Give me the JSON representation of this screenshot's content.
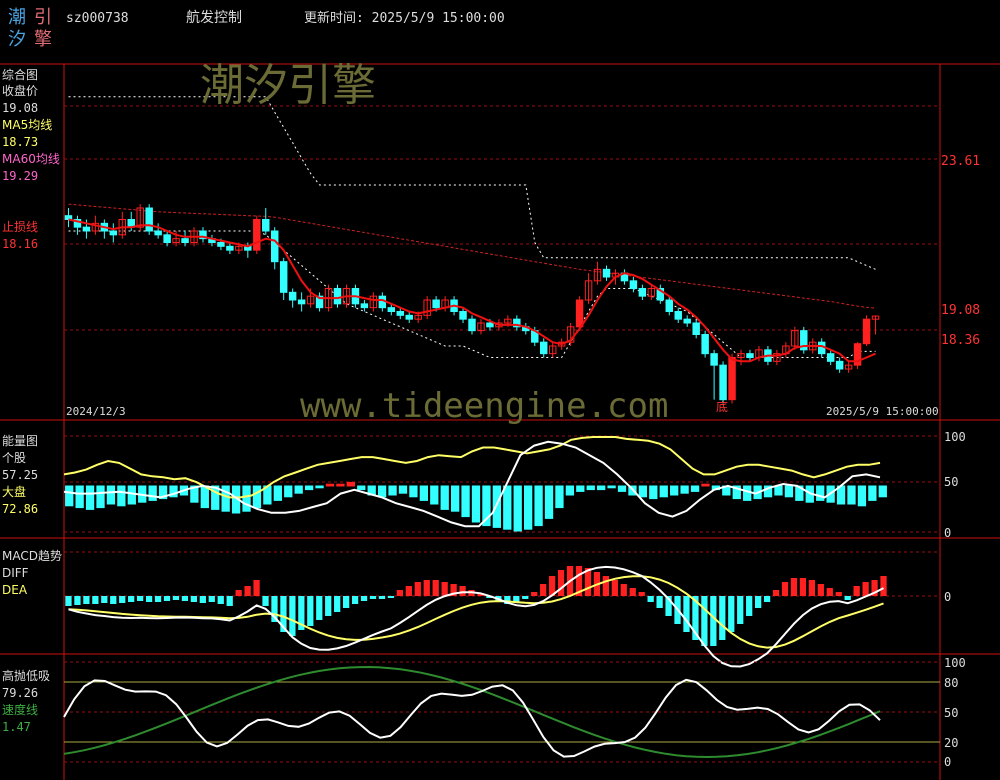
{
  "header": {
    "logo_chars": [
      "潮",
      "引",
      "汐",
      "擎"
    ],
    "stock_code": "sz000738",
    "stock_name": "航发控制",
    "update_label": "更新时间: 2025/5/9 15:00:00"
  },
  "colors": {
    "up": "#ff2020",
    "down": "#33ffff",
    "ma5": "#ffff66",
    "ma60": "#ff66cc",
    "stoploss": "#ff3333",
    "grid": "#aa1111",
    "white": "#ffffff",
    "green": "#2e8b2e"
  },
  "watermark": {
    "cn": "潮汐引擎",
    "url": "www.tideengine.com"
  },
  "panel_main": {
    "title": "综合图",
    "close_label": "收盘价",
    "close_value": "19.08",
    "ma5_label": "MA5均线",
    "ma5_value": "18.73",
    "ma60_label": "MA60均线",
    "ma60_value": "19.29",
    "stop_label": "止损线",
    "stop_value": "18.16",
    "right_ticks": [
      "23.61",
      "19.08",
      "18.36"
    ],
    "bottom_marker": "底",
    "date_start": "2024/12/3",
    "date_end": "2025/5/9 15:00:00"
  },
  "panel_energy": {
    "title": "能量图",
    "stock_label": "个股",
    "stock_value": "57.25",
    "market_label": "大盘",
    "market_value": "72.86",
    "right_ticks": [
      "100",
      "50",
      "0"
    ]
  },
  "panel_macd": {
    "title": "MACD趋势",
    "diff_label": "DIFF",
    "dea_label": "DEA",
    "right_ticks": [
      "0"
    ]
  },
  "panel_gpdx": {
    "title": "高抛低吸",
    "value": "79.26",
    "speed_label": "速度线",
    "speed_value": "1.47",
    "right_ticks": [
      "100",
      "80",
      "50",
      "20",
      "0"
    ]
  },
  "chart_data": {
    "type": "candlestick",
    "ylim": [
      16.5,
      25.5
    ],
    "dates_span": [
      "2024/12/3",
      "2025/5/9"
    ],
    "candles": [
      [
        21.7,
        21.6,
        21.9,
        21.4
      ],
      [
        21.6,
        21.4,
        21.7,
        21.2
      ],
      [
        21.4,
        21.3,
        21.6,
        21.1
      ],
      [
        21.3,
        21.5,
        21.7,
        21.2
      ],
      [
        21.5,
        21.3,
        21.6,
        21.1
      ],
      [
        21.3,
        21.2,
        21.5,
        21.0
      ],
      [
        21.2,
        21.6,
        21.8,
        21.1
      ],
      [
        21.6,
        21.4,
        21.8,
        21.3
      ],
      [
        21.4,
        21.9,
        22.0,
        21.3
      ],
      [
        21.9,
        21.3,
        22.0,
        21.2
      ],
      [
        21.3,
        21.2,
        21.5,
        21.1
      ],
      [
        21.2,
        21.0,
        21.3,
        20.9
      ],
      [
        21.0,
        21.1,
        21.3,
        20.9
      ],
      [
        21.1,
        21.0,
        21.3,
        20.9
      ],
      [
        21.0,
        21.3,
        21.4,
        20.9
      ],
      [
        21.3,
        21.1,
        21.4,
        21.0
      ],
      [
        21.1,
        21.0,
        21.2,
        20.9
      ],
      [
        21.0,
        20.9,
        21.1,
        20.8
      ],
      [
        20.9,
        20.8,
        21.0,
        20.7
      ],
      [
        20.8,
        20.9,
        21.0,
        20.7
      ],
      [
        20.9,
        20.8,
        21.0,
        20.6
      ],
      [
        20.8,
        21.6,
        21.7,
        20.7
      ],
      [
        21.6,
        21.3,
        21.9,
        21.2
      ],
      [
        21.3,
        20.5,
        21.4,
        20.3
      ],
      [
        20.5,
        19.7,
        20.6,
        19.5
      ],
      [
        19.7,
        19.5,
        19.8,
        19.3
      ],
      [
        19.5,
        19.4,
        19.7,
        19.2
      ],
      [
        19.4,
        19.6,
        19.8,
        19.3
      ],
      [
        19.6,
        19.3,
        19.7,
        19.2
      ],
      [
        19.3,
        19.8,
        19.9,
        19.2
      ],
      [
        19.8,
        19.4,
        19.9,
        19.3
      ],
      [
        19.4,
        19.8,
        19.9,
        19.3
      ],
      [
        19.8,
        19.4,
        19.9,
        19.3
      ],
      [
        19.4,
        19.3,
        19.5,
        19.2
      ],
      [
        19.3,
        19.6,
        19.7,
        19.2
      ],
      [
        19.6,
        19.3,
        19.7,
        19.2
      ],
      [
        19.3,
        19.2,
        19.4,
        19.1
      ],
      [
        19.2,
        19.1,
        19.3,
        19.0
      ],
      [
        19.1,
        19.0,
        19.2,
        18.9
      ],
      [
        19.0,
        19.1,
        19.2,
        18.9
      ],
      [
        19.1,
        19.5,
        19.6,
        19.0
      ],
      [
        19.5,
        19.3,
        19.6,
        19.2
      ],
      [
        19.3,
        19.5,
        19.6,
        19.2
      ],
      [
        19.5,
        19.2,
        19.6,
        19.1
      ],
      [
        19.2,
        19.0,
        19.3,
        18.9
      ],
      [
        19.0,
        18.7,
        19.1,
        18.6
      ],
      [
        18.7,
        18.9,
        19.0,
        18.6
      ],
      [
        18.9,
        18.8,
        19.0,
        18.7
      ],
      [
        18.8,
        18.9,
        19.0,
        18.7
      ],
      [
        18.9,
        19.0,
        19.1,
        18.8
      ],
      [
        19.0,
        18.8,
        19.1,
        18.7
      ],
      [
        18.8,
        18.7,
        18.9,
        18.6
      ],
      [
        18.7,
        18.4,
        18.8,
        18.3
      ],
      [
        18.4,
        18.1,
        18.5,
        18.0
      ],
      [
        18.1,
        18.3,
        18.4,
        18.0
      ],
      [
        18.3,
        18.4,
        18.5,
        18.2
      ],
      [
        18.4,
        18.8,
        18.9,
        18.3
      ],
      [
        18.8,
        19.5,
        19.6,
        18.7
      ],
      [
        19.5,
        20.0,
        20.2,
        19.4
      ],
      [
        20.0,
        20.3,
        20.5,
        19.9
      ],
      [
        20.3,
        20.1,
        20.4,
        20.0
      ],
      [
        20.1,
        20.2,
        20.3,
        19.9
      ],
      [
        20.2,
        20.0,
        20.3,
        19.9
      ],
      [
        20.0,
        19.8,
        20.1,
        19.7
      ],
      [
        19.8,
        19.6,
        19.9,
        19.5
      ],
      [
        19.6,
        19.8,
        19.9,
        19.5
      ],
      [
        19.8,
        19.5,
        19.9,
        19.4
      ],
      [
        19.5,
        19.2,
        19.6,
        19.1
      ],
      [
        19.2,
        19.0,
        19.3,
        18.9
      ],
      [
        19.0,
        18.9,
        19.1,
        18.8
      ],
      [
        18.9,
        18.6,
        19.0,
        18.5
      ],
      [
        18.6,
        18.1,
        18.7,
        18.0
      ],
      [
        18.1,
        17.8,
        18.2,
        16.9
      ],
      [
        17.8,
        16.9,
        17.9,
        16.8
      ],
      [
        16.9,
        18.0,
        18.1,
        16.8
      ],
      [
        18.0,
        18.1,
        18.2,
        17.8
      ],
      [
        18.1,
        18.0,
        18.2,
        17.9
      ],
      [
        18.0,
        18.2,
        18.3,
        17.9
      ],
      [
        18.2,
        17.9,
        18.3,
        17.8
      ],
      [
        17.9,
        18.1,
        18.2,
        17.8
      ],
      [
        18.1,
        18.3,
        18.4,
        18.0
      ],
      [
        18.3,
        18.7,
        18.8,
        18.2
      ],
      [
        18.7,
        18.2,
        18.8,
        18.1
      ],
      [
        18.2,
        18.4,
        18.5,
        18.1
      ],
      [
        18.4,
        18.1,
        18.5,
        18.0
      ],
      [
        18.1,
        17.9,
        18.2,
        17.8
      ],
      [
        17.9,
        17.7,
        18.0,
        17.6
      ],
      [
        17.7,
        17.8,
        17.9,
        17.6
      ],
      [
        17.8,
        18.36,
        18.4,
        17.7
      ],
      [
        18.36,
        19.0,
        19.1,
        18.3
      ],
      [
        19.0,
        19.08,
        19.1,
        18.6
      ]
    ],
    "ma5": [
      21.6,
      21.55,
      21.5,
      21.45,
      21.4,
      21.35,
      21.4,
      21.4,
      21.45,
      21.45,
      21.4,
      21.3,
      21.2,
      21.15,
      21.15,
      21.15,
      21.1,
      21.05,
      21.0,
      20.95,
      20.9,
      21.0,
      21.1,
      21.05,
      20.8,
      20.4,
      20.0,
      19.7,
      19.55,
      19.55,
      19.55,
      19.6,
      19.6,
      19.55,
      19.5,
      19.5,
      19.4,
      19.3,
      19.2,
      19.15,
      19.2,
      19.25,
      19.3,
      19.35,
      19.3,
      19.15,
      19.05,
      18.95,
      18.85,
      18.85,
      18.85,
      18.8,
      18.7,
      18.55,
      18.4,
      18.35,
      18.45,
      18.75,
      19.1,
      19.5,
      19.85,
      20.1,
      20.2,
      20.15,
      20.05,
      19.9,
      19.75,
      19.6,
      19.4,
      19.25,
      19.05,
      18.8,
      18.5,
      18.2,
      17.95,
      17.9,
      17.9,
      18.0,
      18.05,
      18.05,
      18.1,
      18.25,
      18.3,
      18.3,
      18.3,
      18.2,
      18.1,
      17.9,
      17.9,
      18.0,
      18.1
    ],
    "ma60": [
      22.0,
      21.98,
      21.96,
      21.94,
      21.92,
      21.9,
      21.88,
      21.86,
      21.84,
      21.82,
      21.8,
      21.79,
      21.78,
      21.77,
      21.76,
      21.75,
      21.74,
      21.73,
      21.72,
      21.71,
      21.7,
      21.69,
      21.68,
      21.66,
      21.62,
      21.58,
      21.54,
      21.5,
      21.46,
      21.42,
      21.38,
      21.34,
      21.3,
      21.26,
      21.22,
      21.18,
      21.14,
      21.1,
      21.06,
      21.02,
      20.98,
      20.94,
      20.9,
      20.86,
      20.82,
      20.78,
      20.74,
      20.7,
      20.66,
      20.62,
      20.58,
      20.54,
      20.5,
      20.46,
      20.42,
      20.38,
      20.34,
      20.3,
      20.27,
      20.24,
      20.21,
      20.18,
      20.15,
      20.12,
      20.09,
      20.06,
      20.03,
      20.0,
      19.97,
      19.94,
      19.91,
      19.88,
      19.85,
      19.82,
      19.79,
      19.76,
      19.73,
      19.7,
      19.67,
      19.64,
      19.61,
      19.58,
      19.55,
      19.52,
      19.49,
      19.46,
      19.42,
      19.38,
      19.34,
      19.31,
      19.29
    ],
    "stoploss": [
      21.3,
      21.3,
      21.3,
      21.3,
      21.3,
      21.3,
      21.3,
      21.3,
      21.3,
      21.3,
      21.3,
      21.3,
      21.3,
      21.3,
      21.3,
      21.3,
      21.3,
      21.3,
      21.3,
      21.3,
      21.3,
      21.3,
      21.2,
      21.0,
      20.8,
      20.6,
      20.4,
      20.2,
      20.0,
      19.8,
      19.6,
      19.4,
      19.3,
      19.2,
      19.1,
      19.0,
      18.9,
      18.8,
      18.7,
      18.6,
      18.5,
      18.4,
      18.3,
      18.3,
      18.3,
      18.2,
      18.1,
      18.0,
      18.0,
      18.0,
      18.0,
      18.0,
      18.0,
      18.0,
      18.0,
      18.0,
      18.4,
      18.8,
      19.2,
      19.6,
      19.8,
      19.8,
      19.8,
      19.8,
      19.7,
      19.6,
      19.5,
      19.4,
      19.3,
      19.2,
      19.0,
      18.8,
      18.6,
      18.4,
      18.2,
      18.0,
      18.0,
      18.0,
      18.0,
      18.0,
      18.0,
      18.0,
      18.0,
      18.0,
      18.0,
      18.0,
      18.0,
      18.0,
      18.16,
      18.16,
      18.16
    ],
    "resistance": [
      24.8,
      24.8,
      24.8,
      24.8,
      24.8,
      24.8,
      24.8,
      24.8,
      24.8,
      24.8,
      24.8,
      24.8,
      24.8,
      24.8,
      24.8,
      24.8,
      24.8,
      24.8,
      24.8,
      24.8,
      24.8,
      24.8,
      24.8,
      24.4,
      24.0,
      23.6,
      23.2,
      22.8,
      22.5,
      22.5,
      22.5,
      22.5,
      22.5,
      22.5,
      22.5,
      22.5,
      22.5,
      22.5,
      22.5,
      22.5,
      22.5,
      22.5,
      22.5,
      22.5,
      22.5,
      22.5,
      22.5,
      22.5,
      22.5,
      22.5,
      22.5,
      22.5,
      21.0,
      20.6,
      20.6,
      20.6,
      20.6,
      20.6,
      20.6,
      20.6,
      20.6,
      20.6,
      20.6,
      20.6,
      20.6,
      20.6,
      20.6,
      20.6,
      20.6,
      20.6,
      20.6,
      20.6,
      20.6,
      20.6,
      20.6,
      20.6,
      20.6,
      20.6,
      20.6,
      20.6,
      20.6,
      20.6,
      20.6,
      20.6,
      20.6,
      20.6,
      20.6,
      20.6,
      20.5,
      20.4,
      20.3
    ],
    "energy_market": [
      60,
      62,
      65,
      70,
      74,
      72,
      66,
      60,
      58,
      57,
      55,
      56,
      52,
      46,
      40,
      36,
      36,
      38,
      44,
      52,
      58,
      62,
      66,
      70,
      72,
      74,
      76,
      78,
      78,
      76,
      74,
      72,
      74,
      78,
      80,
      79,
      78,
      84,
      88,
      88,
      86,
      84,
      82,
      84,
      86,
      90,
      96,
      98,
      99,
      99,
      99,
      97,
      96,
      95,
      92,
      86,
      76,
      66,
      60,
      60,
      64,
      68,
      70,
      70,
      68,
      66,
      64,
      60,
      57,
      60,
      64,
      68,
      70,
      70,
      72
    ],
    "energy_stock": [
      42,
      40,
      40,
      41,
      42,
      40,
      38,
      36,
      40,
      45,
      48,
      46,
      40,
      30,
      24,
      20,
      20,
      22,
      26,
      30,
      40,
      44,
      40,
      36,
      30,
      26,
      22,
      16,
      10,
      6,
      6,
      20,
      50,
      80,
      90,
      94,
      92,
      88,
      80,
      72,
      60,
      46,
      30,
      20,
      16,
      22,
      34,
      44,
      48,
      44,
      40,
      46,
      50,
      48,
      40,
      36,
      46,
      58,
      60,
      57
    ],
    "energy_bars": [
      -22,
      -24,
      -26,
      -24,
      -20,
      -22,
      -20,
      -18,
      -16,
      -14,
      -12,
      -10,
      -18,
      -24,
      -26,
      -28,
      -30,
      -28,
      -24,
      -20,
      -16,
      -12,
      -8,
      -4,
      -2,
      2,
      2,
      4,
      -4,
      -10,
      -12,
      -10,
      -8,
      -12,
      -16,
      -20,
      -26,
      -28,
      -34,
      -40,
      -44,
      -46,
      -48,
      -50,
      -48,
      -44,
      -36,
      -24,
      -10,
      -6,
      -4,
      -4,
      -2,
      -6,
      -10,
      -12,
      -14,
      -12,
      -10,
      -8,
      -6,
      2,
      -4,
      -10,
      -14,
      -16,
      -14,
      -12,
      -10,
      -12,
      -16,
      -18,
      -16,
      -18,
      -20,
      -20,
      -22,
      -16,
      -12
    ],
    "macd_bars": [
      -10,
      -9,
      -8,
      -8,
      -7,
      -8,
      -7,
      -6,
      -5,
      -6,
      -6,
      -5,
      -4,
      -5,
      -6,
      -7,
      -6,
      -8,
      -10,
      6,
      10,
      16,
      -10,
      -26,
      -36,
      -40,
      -34,
      -30,
      -24,
      -20,
      -16,
      -12,
      -8,
      -5,
      -3,
      -3,
      -2,
      6,
      10,
      14,
      16,
      16,
      14,
      12,
      10,
      6,
      3,
      -2,
      -5,
      -8,
      -6,
      -3,
      4,
      12,
      20,
      26,
      30,
      30,
      28,
      24,
      20,
      16,
      12,
      8,
      4,
      -6,
      -12,
      -20,
      -28,
      -36,
      -44,
      -50,
      -50,
      -44,
      -36,
      -28,
      -20,
      -12,
      -6,
      6,
      14,
      18,
      18,
      16,
      12,
      8,
      4,
      -4,
      10,
      14,
      16,
      20
    ]
  }
}
